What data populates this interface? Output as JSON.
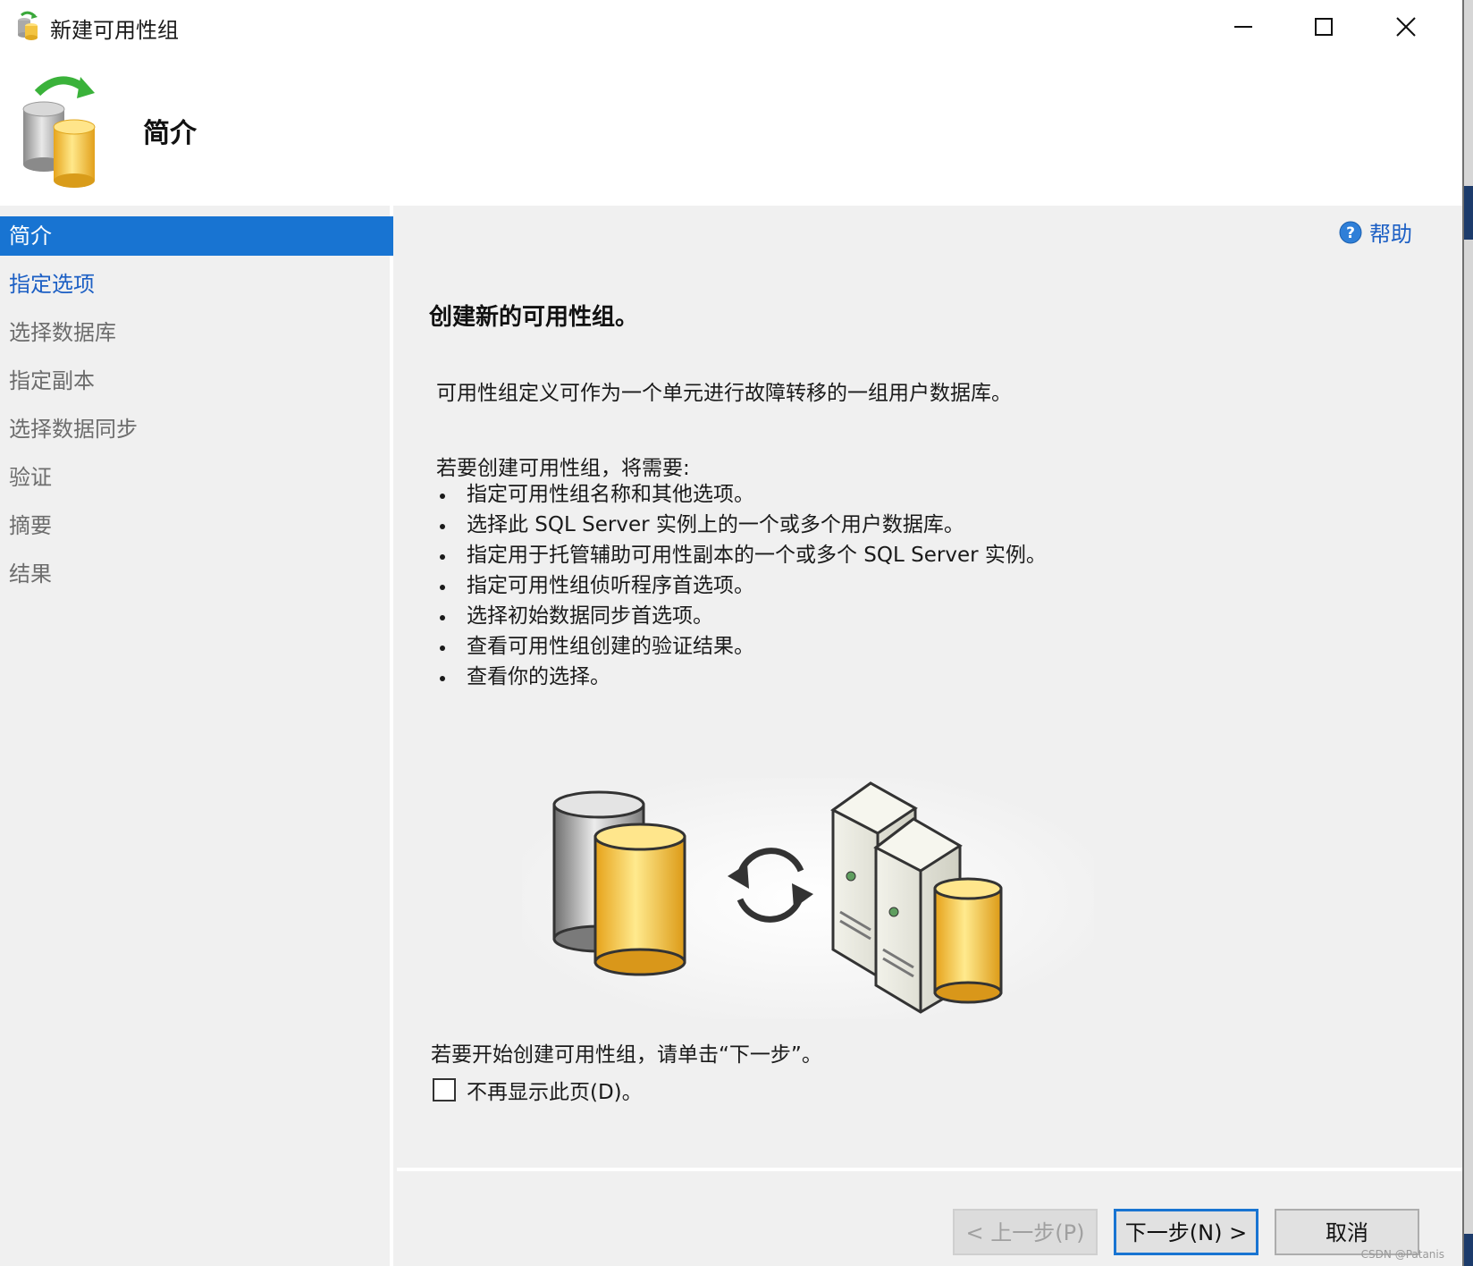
{
  "window": {
    "title": "新建可用性组",
    "icon": "availability-group-icon",
    "controls": [
      "minimize-icon",
      "maximize-icon",
      "close-icon"
    ]
  },
  "header": {
    "title": "简介",
    "icon": "database-sync-icon"
  },
  "sidebar": {
    "items": [
      {
        "label": "简介",
        "state": "selected"
      },
      {
        "label": "指定选项",
        "state": "link"
      },
      {
        "label": "选择数据库",
        "state": "disabled"
      },
      {
        "label": "指定副本",
        "state": "disabled"
      },
      {
        "label": "选择数据同步",
        "state": "disabled"
      },
      {
        "label": "验证",
        "state": "disabled"
      },
      {
        "label": "摘要",
        "state": "disabled"
      },
      {
        "label": "结果",
        "state": "disabled"
      }
    ]
  },
  "main": {
    "help_label": "帮助",
    "title": "创建新的可用性组。",
    "description": "可用性组定义可作为一个单元进行故障转移的一组用户数据库。",
    "requirements_intro": "若要创建可用性组，将需要:",
    "requirements": [
      "指定可用性组名称和其他选项。",
      "选择此 SQL Server 实例上的一个或多个用户数据库。",
      "指定用于托管辅助可用性副本的一个或多个 SQL Server 实例。",
      "指定可用性组侦听程序首选项。",
      "选择初始数据同步首选项。",
      "查看可用性组创建的验证结果。",
      "查看你的选择。"
    ],
    "start_hint": "若要开始创建可用性组，请单击“下一步”。",
    "checkbox_label": "不再显示此页(D)。",
    "checkbox_checked": false
  },
  "footer": {
    "prev_label": "< 上一步(P)",
    "next_label": "下一步(N) >",
    "cancel_label": "取消"
  },
  "watermark": "CSDN @Patanis",
  "colors": {
    "selection": "#1874d2",
    "link": "#1c5fc4",
    "background": "#f0f0f0"
  }
}
